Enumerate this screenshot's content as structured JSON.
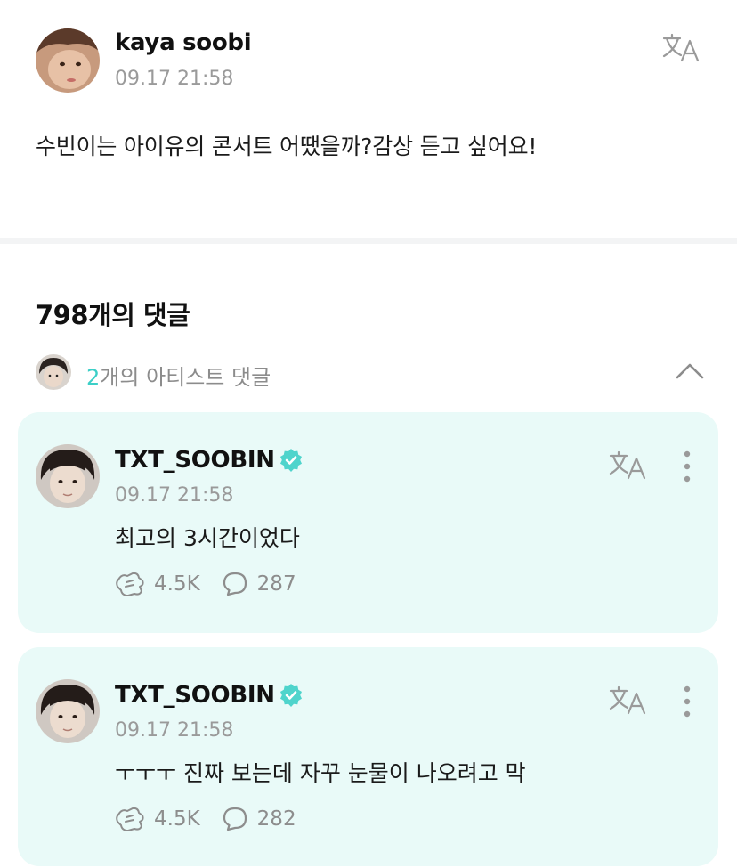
{
  "post": {
    "author": "kaya soobi",
    "time": "09.17 21:58",
    "body": "수빈이는 아이유의 콘서트 어땠을까?감상 듣고 싶어요!"
  },
  "comments_section": {
    "count_label": "798개의 댓글",
    "artist_count": "2",
    "artist_label_suffix": "개의 아티스트 댓글"
  },
  "artist_comments": [
    {
      "author": "TXT_SOOBIN",
      "time": "09.17 21:58",
      "text": "최고의 3시간이었다",
      "likes": "4.5K",
      "replies": "287"
    },
    {
      "author": "TXT_SOOBIN",
      "time": "09.17 21:58",
      "text": "ㅜㅜㅜ 진짜 보는데 자꾸 눈물이 나오려고 막",
      "likes": "4.5K",
      "replies": "282"
    }
  ],
  "colors": {
    "accent": "#3ccfc7",
    "card_background": "#e9faf8",
    "muted_text": "#9a9a9a",
    "verified_badge": "#4fd4cc"
  },
  "icons": [
    "translate-icon",
    "chevron-up-icon",
    "verified-badge-icon",
    "more-vertical-icon",
    "cheer-icon",
    "reply-bubble-icon"
  ]
}
